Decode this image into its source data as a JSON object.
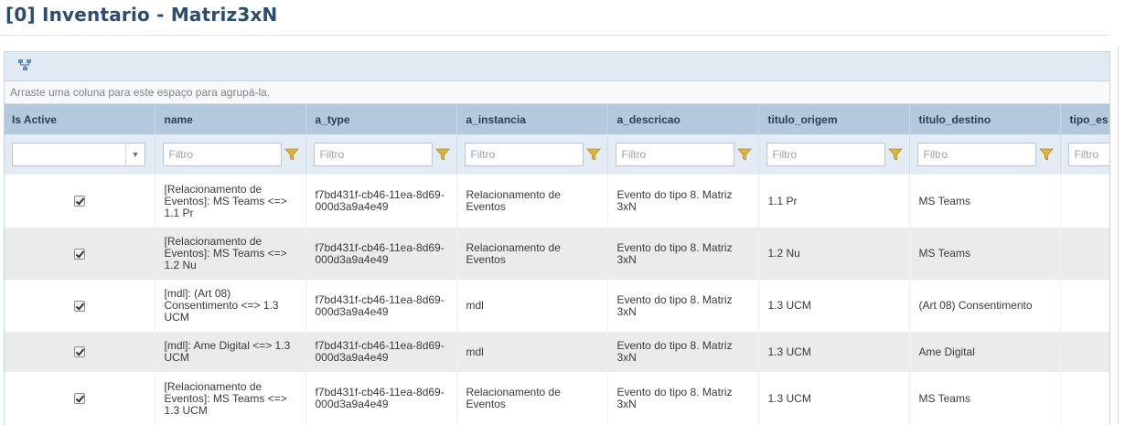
{
  "page": {
    "title": "[0] Inventario - Matriz3xN"
  },
  "toolbar": {
    "icon": "hierarchy-icon"
  },
  "group_panel": {
    "text": "Arraste uma coluna para este espaço para agrupá-la."
  },
  "columns": [
    "Is Active",
    "name",
    "a_type",
    "a_instancia",
    "a_descricao",
    "titulo_origem",
    "titulo_destino",
    "tipo_es"
  ],
  "filter": {
    "placeholder": "Filtro",
    "select_value": ""
  },
  "rows": [
    {
      "is_active": true,
      "name": "[Relacionamento de Eventos]: MS Teams <=> 1.1 Pr",
      "a_type": "f7bd431f-cb46-11ea-8d69-000d3a9a4e49",
      "a_instancia": "Relacionamento de Eventos",
      "a_descricao": "Evento do tipo 8. Matriz 3xN",
      "titulo_origem": "1.1 Pr",
      "titulo_destino": "MS Teams",
      "tipo_es": ""
    },
    {
      "is_active": true,
      "name": "[Relacionamento de Eventos]: MS Teams <=> 1.2 Nu",
      "a_type": "f7bd431f-cb46-11ea-8d69-000d3a9a4e49",
      "a_instancia": "Relacionamento de Eventos",
      "a_descricao": "Evento do tipo 8. Matriz 3xN",
      "titulo_origem": "1.2 Nu",
      "titulo_destino": "MS Teams",
      "tipo_es": ""
    },
    {
      "is_active": true,
      "name": "[mdl]: (Art 08) Consentimento <=> 1.3 UCM",
      "a_type": "f7bd431f-cb46-11ea-8d69-000d3a9a4e49",
      "a_instancia": "mdl",
      "a_descricao": "Evento do tipo 8. Matriz 3xN",
      "titulo_origem": "1.3 UCM",
      "titulo_destino": "(Art 08) Consentimento",
      "tipo_es": ""
    },
    {
      "is_active": true,
      "name": "[mdl]: Ame Digital <=> 1.3 UCM",
      "a_type": "f7bd431f-cb46-11ea-8d69-000d3a9a4e49",
      "a_instancia": "mdl",
      "a_descricao": "Evento do tipo 8. Matriz 3xN",
      "titulo_origem": "1.3 UCM",
      "titulo_destino": "Ame Digital",
      "tipo_es": ""
    },
    {
      "is_active": true,
      "name": "[Relacionamento de Eventos]: MS Teams <=> 1.3 UCM",
      "a_type": "f7bd431f-cb46-11ea-8d69-000d3a9a4e49",
      "a_instancia": "Relacionamento de Eventos",
      "a_descricao": "Evento do tipo 8. Matriz 3xN",
      "titulo_origem": "1.3 UCM",
      "titulo_destino": "MS Teams",
      "tipo_es": ""
    }
  ]
}
